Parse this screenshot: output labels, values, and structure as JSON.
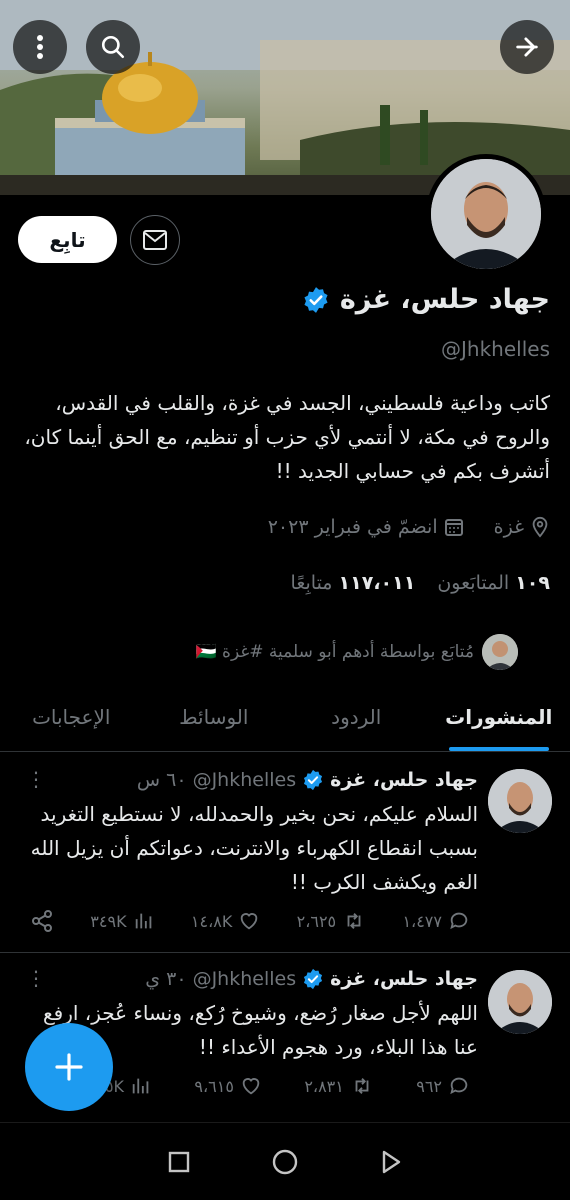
{
  "profile": {
    "name": "جهاد حلس، غزة",
    "handle": "@Jhkhelles",
    "bio": "كاتب وداعية فلسطيني، الجسد في غزة، والقلب في القدس، والروح في مكة، لا أنتمي لأي حزب أو تنظيم، مع الحق أينما كان، أتشرف بكم في حسابي الجديد !!",
    "location": "غزة",
    "joined": "انضمّ في فبراير ٢٠٢٣",
    "followers_count": "١٠٩",
    "followers_label": "المتابَعون",
    "following_count": "١١٧،٠١١",
    "following_label": "متابِعًا",
    "followed_by": "مُتابَع بواسطة أدهم أبو سلمية #غزة 🇵🇸",
    "verified": true
  },
  "buttons": {
    "follow": "تابِع"
  },
  "tabs": [
    {
      "label": "المنشورات",
      "active": true
    },
    {
      "label": "الردود",
      "active": false
    },
    {
      "label": "الوسائط",
      "active": false
    },
    {
      "label": "الإعجابات",
      "active": false
    }
  ],
  "tweets": [
    {
      "name": "جهاد حلس، غزة",
      "handle": "@Jhkhelles",
      "time": "٦٠ س",
      "text": "السلام عليكم، نحن بخير والحمدلله، لا نستطيع التغريد بسبب انقطاع الكهرباء والانترنت، دعواتكم أن يزيل الله الغم ويكشف الكرب !!",
      "replies": "١،٤٧٧",
      "retweets": "٢،٦٢٥",
      "likes": "١٤،٨K",
      "views": "٣٤٩K"
    },
    {
      "name": "جهاد حلس، غزة",
      "handle": "@Jhkhelles",
      "time": "٣٠ ي",
      "text": "اللهم لأجل صغار رُضع، وشيوخ رُكع، ونساء عُجز، ارفع عنا هذا البلاء، ورد هجوم الأعداء !!",
      "replies": "٩٦٢",
      "retweets": "٢،٨٣١",
      "likes": "٩،٦١٥",
      "views": "٠٥K"
    }
  ],
  "colors": {
    "accent": "#1d9bf0",
    "background": "#000000",
    "text": "#e7e9ea",
    "muted": "#71767b"
  }
}
